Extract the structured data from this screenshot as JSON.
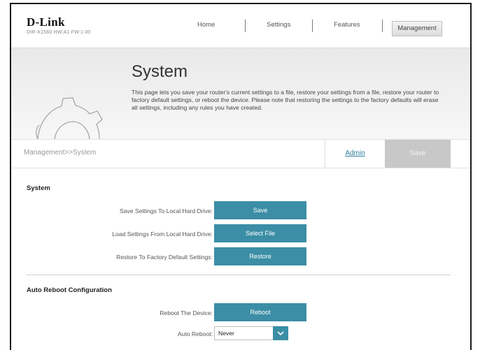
{
  "header": {
    "brand": "D-Link",
    "model": "DIR-X1560 HW:A1 FW:1.00",
    "nav": [
      {
        "label": "Home"
      },
      {
        "label": "Settings"
      },
      {
        "label": "Features"
      },
      {
        "label": "Management"
      }
    ],
    "active_nav": "Management"
  },
  "banner": {
    "title": "System",
    "description": "This page lets you save your router's current settings to a file, restore your settings from a file, restore your router to factory default settings, or reboot the device. Please note that restoring the settings to the factory defaults will erase all settings, including any rules you have created.",
    "icon": "gear-icon"
  },
  "toolbar": {
    "breadcrumb": "Management>>System",
    "admin_label": "Admin",
    "save_label": "Save"
  },
  "system_section": {
    "title": "System",
    "rows": [
      {
        "label": "Save Settings To Local Hard Drive:",
        "button": "Save"
      },
      {
        "label": "Load Settings From Local Hard Drive:",
        "button": "Select File"
      },
      {
        "label": "Restore To Factory Default Settings:",
        "button": "Restore"
      }
    ]
  },
  "reboot_section": {
    "title": "Auto Reboot Configuration",
    "reboot_label": "Reboot The Device:",
    "reboot_button": "Reboot",
    "auto_reboot_label": "Auto Reboot:",
    "auto_reboot_value": "Never"
  },
  "colors": {
    "accent": "#3b8ea5",
    "link": "#2a7d9a",
    "disabled": "#c8c8c8"
  }
}
